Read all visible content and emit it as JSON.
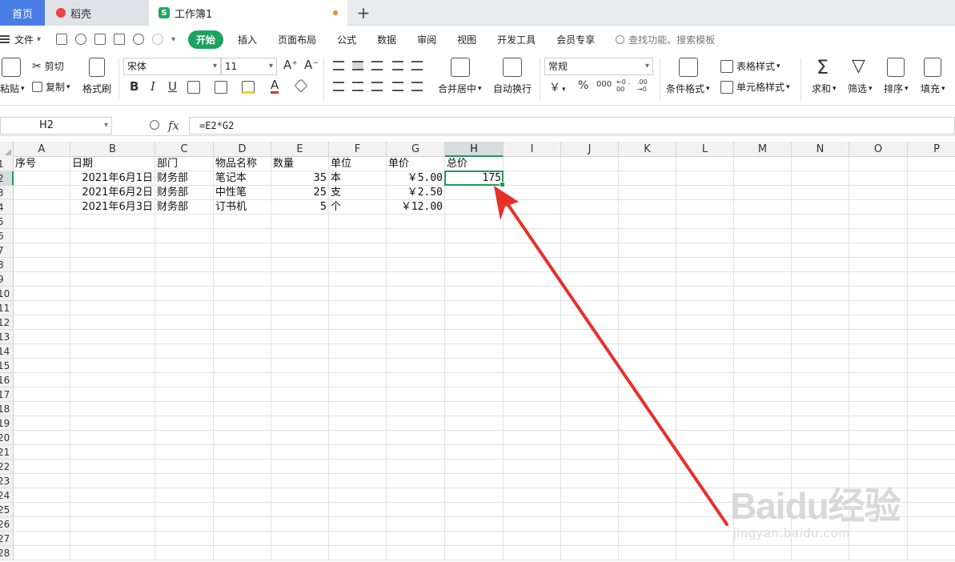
{
  "tabs": {
    "home": "首页",
    "daoke": "稻壳",
    "workbook": "工作簿1",
    "add": "+"
  },
  "menu": {
    "file": "文件",
    "items": [
      "开始",
      "插入",
      "页面布局",
      "公式",
      "数据",
      "审阅",
      "视图",
      "开发工具",
      "会员专享"
    ],
    "search_hint": "查找功能、搜索模板"
  },
  "ribbon": {
    "paste": "粘贴",
    "cut": "剪切",
    "copy": "复制",
    "format_painter": "格式刷",
    "font_name": "宋体",
    "font_size": "11",
    "font_grow": "A⁺",
    "font_shrink": "A⁻",
    "bold": "B",
    "italic": "I",
    "underline": "U",
    "font_color_label": "A",
    "merge_center": "合并居中",
    "wrap_text": "自动换行",
    "number_format": "常规",
    "currency_symbol": "￥",
    "percent": "%",
    "thousands": "000",
    "inc_decimal": "←0 .00",
    "dec_decimal": ".00 →0",
    "conditional_format": "条件格式",
    "table_style": "表格样式",
    "cell_style": "单元格样式",
    "sum": "求和",
    "filter": "筛选",
    "sort": "排序",
    "fill": "填充"
  },
  "formula_bar": {
    "name_box": "H2",
    "fx": "fx",
    "formula": "=E2*G2"
  },
  "columns": [
    "A",
    "B",
    "C",
    "D",
    "E",
    "F",
    "G",
    "H",
    "I",
    "J",
    "K",
    "L",
    "M",
    "N",
    "O",
    "P"
  ],
  "selected_column": "H",
  "selected_row": "2",
  "rows": [
    "1",
    "2",
    "3",
    "4",
    "5",
    "6",
    "7",
    "8",
    "9",
    "10",
    "11",
    "12",
    "13",
    "14",
    "15",
    "16",
    "17",
    "18",
    "19",
    "20",
    "21",
    "22",
    "23",
    "24",
    "25",
    "26",
    "27",
    "28"
  ],
  "sheet": {
    "header": {
      "A": "序号",
      "B": "日期",
      "C": "部门",
      "D": "物品名称",
      "E": "数量",
      "F": "单位",
      "G": "单价",
      "H": "总价"
    },
    "records": [
      {
        "B": "2021年6月1日",
        "C": "财务部",
        "D": "笔记本",
        "E": "35",
        "F": "本",
        "G": "￥5.00",
        "H": "175"
      },
      {
        "B": "2021年6月2日",
        "C": "财务部",
        "D": "中性笔",
        "E": "25",
        "F": "支",
        "G": "￥2.50",
        "H": ""
      },
      {
        "B": "2021年6月3日",
        "C": "财务部",
        "D": "订书机",
        "E": "5",
        "F": "个",
        "G": "￥12.00",
        "H": ""
      }
    ]
  },
  "watermark": {
    "main": "Baidu经验",
    "sub": "jingyan.baidu.com"
  },
  "colors": {
    "accent_green": "#1e9b5a",
    "home_tab_blue": "#4a7de4",
    "annotation_arrow": "#e8302a"
  }
}
